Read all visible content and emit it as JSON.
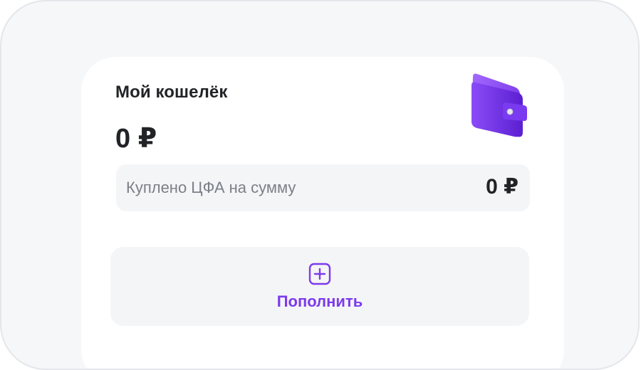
{
  "wallet": {
    "title": "Мой кошелёк",
    "balance": "0 ₽",
    "illustration_icon": "wallet-icon",
    "purchased_label": "Куплено ЦФА на сумму",
    "purchased_value": "0 ₽"
  },
  "topup": {
    "icon": "plus-square-icon",
    "label": "Пополнить"
  },
  "colors": {
    "accent": "#7c3aed",
    "text_primary": "#222327",
    "text_secondary": "#7b7f86",
    "surface_muted": "#f4f5f7",
    "background": "#f6f7f9"
  }
}
